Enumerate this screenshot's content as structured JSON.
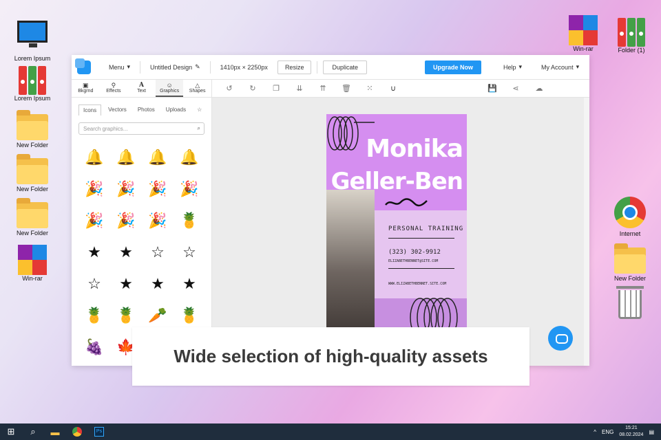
{
  "desktop": {
    "left_icons": [
      {
        "label": "Lorem Ipsum",
        "kind": "computer"
      },
      {
        "label": "Lorem Ipsum",
        "kind": "binders"
      },
      {
        "label": "New Folder",
        "kind": "folder"
      },
      {
        "label": "New Folder",
        "kind": "folder"
      },
      {
        "label": "New Folder",
        "kind": "folder"
      },
      {
        "label": "Win-rar",
        "kind": "winrar"
      }
    ],
    "right_icons": [
      {
        "label": "Win-rar",
        "kind": "winrar"
      },
      {
        "label": "Folder (1)",
        "kind": "binders"
      },
      {
        "label": "Internet",
        "kind": "chrome"
      },
      {
        "label": "New Folder",
        "kind": "folder"
      },
      {
        "label": "",
        "kind": "trash"
      }
    ]
  },
  "editor": {
    "menu_label": "Menu",
    "doc_title": "Untitled Design",
    "doc_size": "1410px × 2250px",
    "resize_label": "Resize",
    "duplicate_label": "Duplicate",
    "upgrade_label": "Upgrade Now",
    "help_label": "Help",
    "account_label": "My Account",
    "side_tabs": [
      {
        "label": "Bkgrnd",
        "icon": "image-icon"
      },
      {
        "label": "Effects",
        "icon": "wand-icon"
      },
      {
        "label": "Text",
        "icon": "text-icon"
      },
      {
        "label": "Graphics",
        "icon": "smiley-icon"
      },
      {
        "label": "Shapes",
        "icon": "triangle-icon"
      }
    ],
    "asset_tabs": [
      "Icons",
      "Vectors",
      "Photos",
      "Uploads"
    ],
    "search_placeholder": "Search graphics...",
    "icon_rows": [
      [
        "🔔",
        "🔔",
        "🔔",
        "🔔"
      ],
      [
        "🎉",
        "🎉",
        "🎉",
        "🎉"
      ],
      [
        "🎉",
        "🎉",
        "🎉",
        "🍍"
      ],
      [
        "★",
        "★",
        "☆",
        "☆"
      ],
      [
        "☆",
        "★",
        "★",
        "★"
      ],
      [
        "🍍",
        "🍍",
        "🥕",
        "🍍"
      ],
      [
        "🍇",
        "🍁",
        "",
        ""
      ]
    ]
  },
  "design": {
    "name_line1": "Monika",
    "name_line2": "Geller-Ben",
    "service": "PERSONAL TRAINING",
    "phone": "(323) 302-9912",
    "email": "ELIZABETHBENNET@SITE.COM",
    "website": "WWW.ELIZABETHBENNET.SITE.COM"
  },
  "caption": "Wide selection of high-quality assets",
  "taskbar": {
    "lang": "ENG",
    "time": "15:21",
    "date": "08.02.2024"
  },
  "colors": {
    "accent": "#2196f3",
    "card_purple": "#d58ef0"
  }
}
